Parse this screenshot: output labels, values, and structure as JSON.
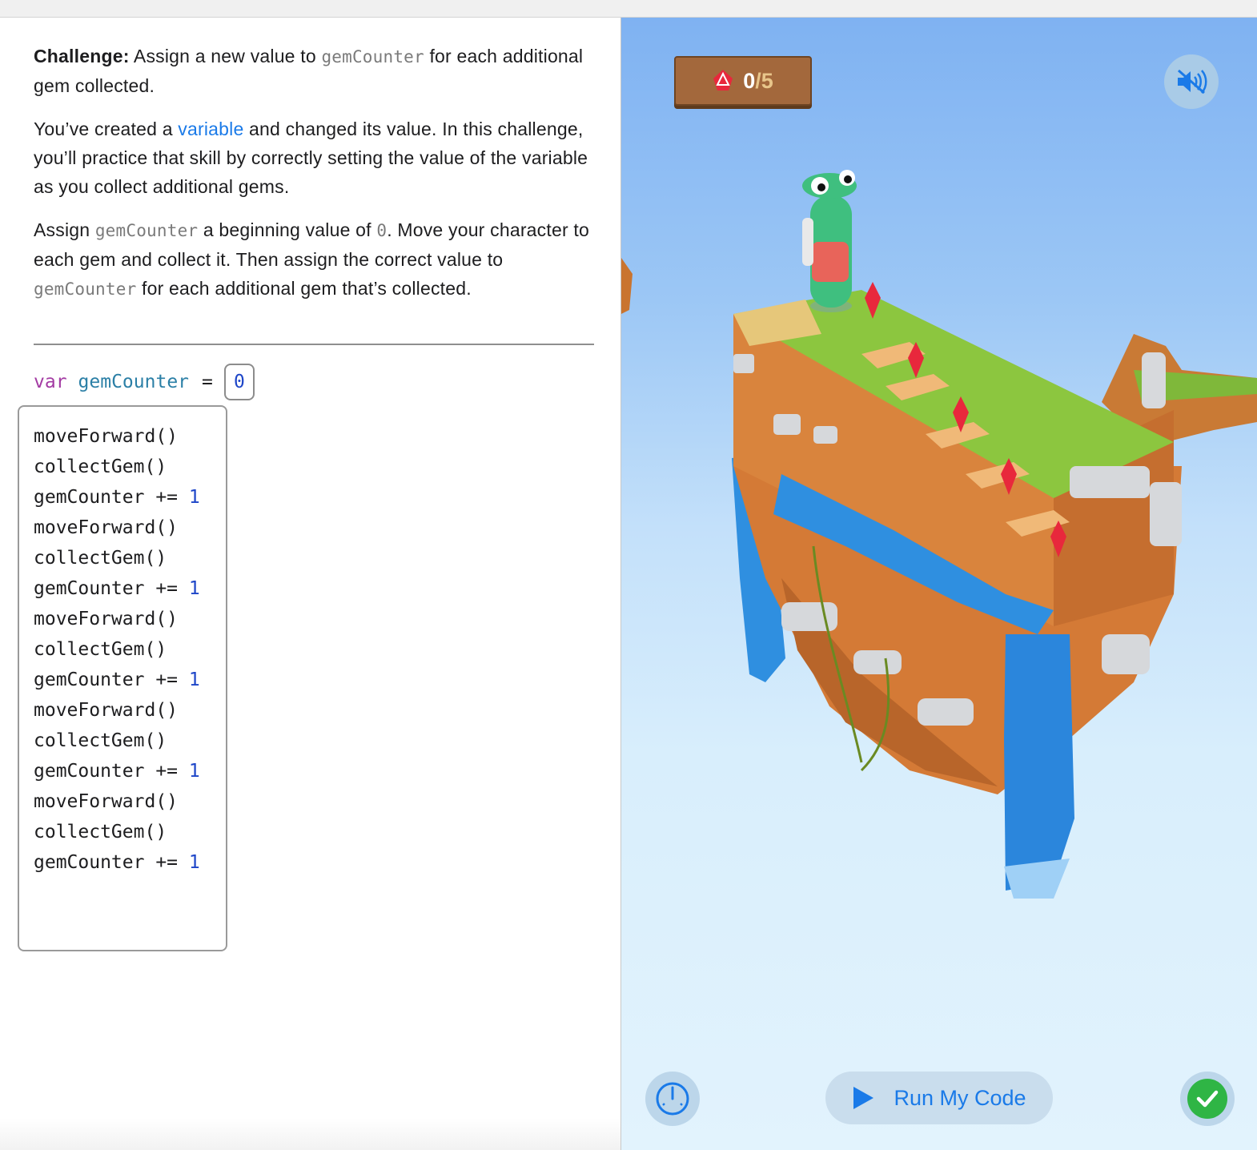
{
  "instructions": {
    "challenge_label": "Challenge:",
    "p1_a": " Assign a new value to ",
    "p1_code": "gemCounter",
    "p1_b": " for each additional gem collected.",
    "p2_a": "You’ve created a ",
    "p2_link": "variable",
    "p2_b": " and changed its value. In this challenge, you’ll practice that skill by correctly setting the value of the variable as you collect additional gems.",
    "p3_a": "Assign ",
    "p3_code1": "gemCounter",
    "p3_b": " a beginning value of ",
    "p3_code2": "0",
    "p3_c": ". Move your character to each gem and collect it. Then assign the correct value to ",
    "p3_code3": "gemCounter",
    "p3_d": " for each additional gem that’s collected."
  },
  "declaration": {
    "keyword": "var",
    "name": "gemCounter",
    "operator": "=",
    "value": "0"
  },
  "code_lines": [
    {
      "text": "moveForward()",
      "num": ""
    },
    {
      "text": "collectGem()",
      "num": ""
    },
    {
      "text": "gemCounter += ",
      "num": "1"
    },
    {
      "text": "moveForward()",
      "num": ""
    },
    {
      "text": "collectGem()",
      "num": ""
    },
    {
      "text": "gemCounter += ",
      "num": "1"
    },
    {
      "text": "moveForward()",
      "num": ""
    },
    {
      "text": "collectGem()",
      "num": ""
    },
    {
      "text": "gemCounter += ",
      "num": "1"
    },
    {
      "text": "moveForward()",
      "num": ""
    },
    {
      "text": "collectGem()",
      "num": ""
    },
    {
      "text": "gemCounter += ",
      "num": "1"
    },
    {
      "text": "moveForward()",
      "num": ""
    },
    {
      "text": "collectGem()",
      "num": ""
    },
    {
      "text": "gemCounter += ",
      "num": "1"
    }
  ],
  "game": {
    "gems_collected": "0",
    "gems_total": "/5",
    "run_button_label": "Run My Code",
    "icons": {
      "counter": "gem-icon",
      "mute": "speaker-muted-icon",
      "speed": "speedometer-icon",
      "run": "play-icon",
      "check": "checkmark-icon"
    },
    "colors": {
      "accent": "#1a7ae8",
      "gem": "#e8283c",
      "success": "#2fb545"
    }
  }
}
